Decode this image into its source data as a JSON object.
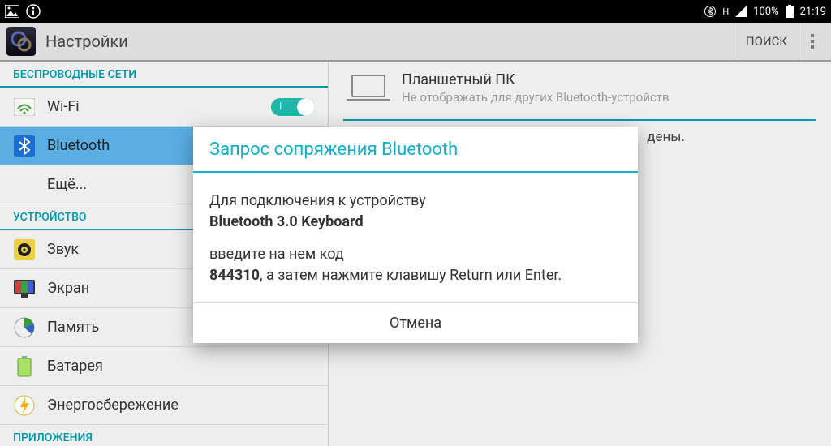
{
  "status": {
    "battery_pct": "100%",
    "time": "21:19",
    "signal_label": "H"
  },
  "header": {
    "title": "Настройки",
    "search": "ПОИСК"
  },
  "sidebar": {
    "wireless_header": "БЕСПРОВОДНЫЕ СЕТИ",
    "wifi": "Wi-Fi",
    "bluetooth": "Bluetooth",
    "more": "Ещё...",
    "device_header": "УСТРОЙСТВО",
    "sound": "Звук",
    "display": "Экран",
    "storage": "Память",
    "battery": "Батарея",
    "power": "Энергосбережение",
    "apps_header": "ПРИЛОЖЕНИЯ"
  },
  "content": {
    "device_name": "Планшетный ПК",
    "device_sub": "Не отображать для других Bluetooth-устройств",
    "paired_msg_tail": "дены."
  },
  "modal": {
    "title": "Запрос сопряжения Bluetooth",
    "line1": "Для подключения к устройству",
    "device": "Bluetooth 3.0 Keyboard",
    "line2a": "введите на нем код",
    "code": "844310",
    "line2b": ", а затем нажмите клавишу Return или Enter.",
    "cancel": "Отмена"
  }
}
